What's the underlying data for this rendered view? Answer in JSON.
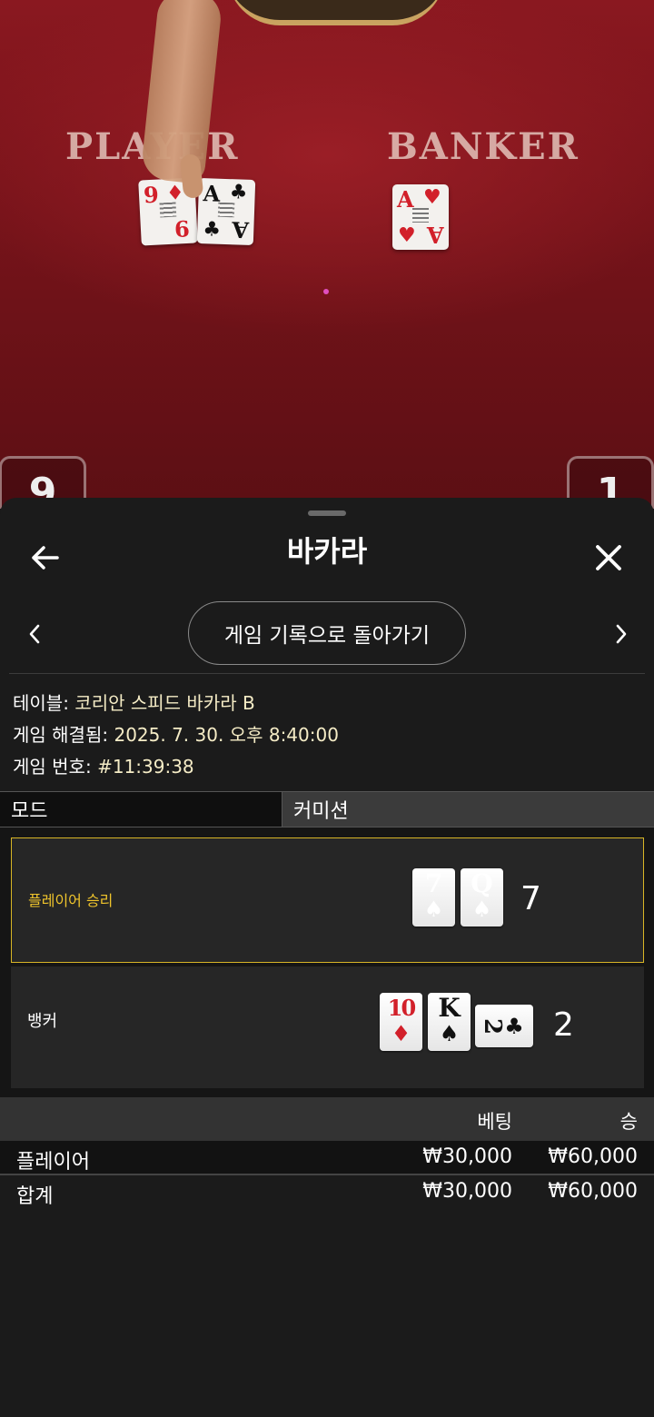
{
  "video": {
    "player_label": "PLAYER",
    "banker_label": "BANKER",
    "player_score": "9",
    "banker_score": "1",
    "table_cards": [
      {
        "rank": "9",
        "suit": "♦",
        "color": "#d2202a"
      },
      {
        "rank": "A",
        "suit": "♣",
        "color": "#111111"
      },
      {
        "rank": "A",
        "suit": "♥",
        "color": "#d2202a"
      }
    ]
  },
  "sheet": {
    "title": "바카라",
    "back_icon": "arrow-left-icon",
    "close_icon": "close-icon",
    "history_button": "게임 기록으로 돌아가기",
    "info": {
      "table_label": "테이블:",
      "table_value": "코리안 스피드 바카라 B",
      "resolved_label": "게임 해결됨:",
      "resolved_value": "2025. 7. 30. 오후 8:40:00",
      "number_label": "게임 번호:",
      "number_value": "#11:39:38"
    },
    "tabs": {
      "mode": "모드",
      "commission": "커미션"
    }
  },
  "result": {
    "player": {
      "label": "플레이어 승리",
      "total": "7",
      "cards": [
        {
          "rank": "7",
          "suit": "♠",
          "color": "#111111"
        },
        {
          "rank": "Q",
          "suit": "♠",
          "color": "#111111"
        }
      ]
    },
    "banker": {
      "label": "뱅커",
      "total": "2",
      "cards": [
        {
          "rank": "10",
          "suit": "♦",
          "color": "#d2202a"
        },
        {
          "rank": "K",
          "suit": "♠",
          "color": "#111111"
        },
        {
          "rank": "2",
          "suit": "♣",
          "color": "#111111"
        }
      ]
    },
    "win_color": "#f0c52c"
  },
  "bets": {
    "head_bet": "베팅",
    "head_win": "승",
    "rows": [
      {
        "label": "플레이어",
        "bet": "₩30,000",
        "win": "₩60,000"
      },
      {
        "label": "합계",
        "bet": "₩30,000",
        "win": "₩60,000"
      }
    ]
  }
}
